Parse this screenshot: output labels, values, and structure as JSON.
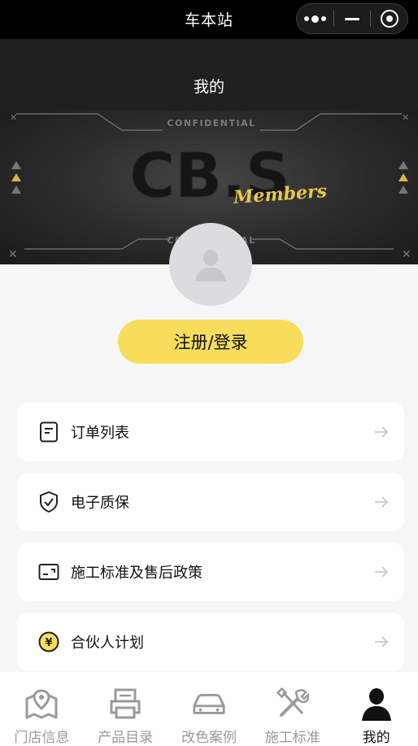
{
  "top_bar": {
    "app_title": "车本站"
  },
  "header": {
    "title": "我的"
  },
  "banner": {
    "top_text": "CONFIDENTIAL",
    "bottom_text": "CONFIDENTIAL",
    "logo_text": "CB.S",
    "logo_script": "Members",
    "accent_color": "#e8c84a"
  },
  "login": {
    "label": "注册/登录",
    "color": "#f7dd5b"
  },
  "menu": [
    {
      "label": "订单列表",
      "icon": "order-list-icon"
    },
    {
      "label": "电子质保",
      "icon": "shield-check-icon"
    },
    {
      "label": "施工标准及售后政策",
      "icon": "policy-card-icon"
    },
    {
      "label": "合伙人计划",
      "icon": "yen-coin-icon"
    }
  ],
  "tabbar": {
    "items": [
      {
        "label": "门店信息",
        "icon": "store-location-icon",
        "active": false
      },
      {
        "label": "产品目录",
        "icon": "printer-catalog-icon",
        "active": false
      },
      {
        "label": "改色案例",
        "icon": "car-icon",
        "active": false
      },
      {
        "label": "施工标准",
        "icon": "tools-icon",
        "active": false
      },
      {
        "label": "我的",
        "icon": "user-icon",
        "active": true
      }
    ]
  }
}
